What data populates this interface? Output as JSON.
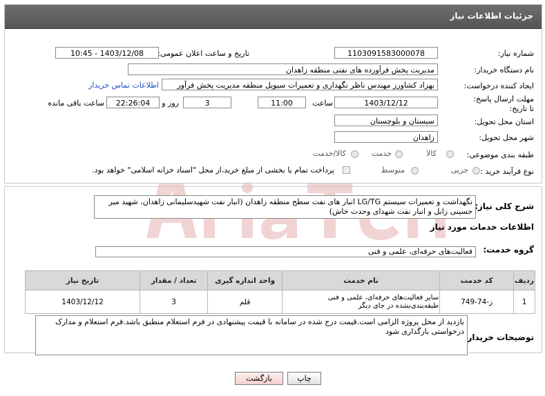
{
  "header": {
    "title": "جزئیات اطلاعات نیاز"
  },
  "fields": {
    "need_number": {
      "label": "شماره نیاز:",
      "value": "1103091583000078"
    },
    "announce_datetime": {
      "label": "تاریخ و ساعت اعلان عمومی:",
      "value": "1403/12/08 - 10:45"
    },
    "buyer_org": {
      "label": "نام دستگاه خریدار:",
      "value": "مدیریت پخش فرآورده های نفتی منطقه زاهدان"
    },
    "requester": {
      "label": "ایجاد کننده درخواست:",
      "value": "بهزاد کشاورز مهندس ناظر نگهداری و تعمیرات سیویل منطقه  مدیریت پخش فرآور"
    },
    "contact_link": "اطلاعات تماس خریدار",
    "deadline": {
      "label": "مهلت ارسال پاسخ: تا تاریخ:",
      "date": "1403/12/12",
      "time_label": "ساعت",
      "time": "11:00",
      "days": "3",
      "days_label": "روز و",
      "remaining": "22:26:04",
      "remaining_label": "ساعت باقی مانده"
    },
    "province": {
      "label": "استان محل تحویل:",
      "value": "سیستان و بلوچستان"
    },
    "city": {
      "label": "شهر محل تحویل:",
      "value": "زاهدان"
    },
    "category": {
      "label": "طبقه بندی موضوعی:",
      "options": [
        "کالا",
        "خدمت",
        "کالا/خدمت"
      ]
    },
    "purchase_type": {
      "label": "نوع فرآیند خرید :",
      "options": [
        "جزیی",
        "متوسط"
      ],
      "note": "پرداخت تمام یا بخشی از مبلغ خرید،از محل \"اسناد خزانه اسلامی\" خواهد بود."
    }
  },
  "summary": {
    "label": "شرح کلی نیاز:",
    "text": "نگهداشت و تعمیرات سیستم LG/TG  انبار های نفت سطح منطقه زاهدان (انبار نفت شهیدسلیمانی زاهدان، شهید میر حسینی زابل و انبار نفت شهدای وحدت خاش)"
  },
  "services": {
    "section_title": "اطلاعات خدمات مورد نیاز",
    "group_label": "گروه خدمت:",
    "group_value": "فعالیت‌های حرفه‌ای، علمی و فنی",
    "columns": [
      "ردیف",
      "کد خدمت",
      "نام خدمت",
      "واحد اندازه گیری",
      "تعداد / مقدار",
      "تاریخ نیاز"
    ],
    "rows": [
      {
        "row": "1",
        "code": "ز-74-749",
        "name": "سایر فعالیت‌های حرفه‌ای، علمی و فنی طبقه‌بندی‌نشده در جای دیگر",
        "unit": "قلم",
        "qty": "3",
        "date": "1403/12/12"
      }
    ]
  },
  "buyer_notes": {
    "label": "توضیحات خریدار:",
    "text": "بازدید از محل پروژه الزامی است.قیمت درج شده در سامانه با قیمت پیشنهادی در فرم استعلام منطبق باشد.فرم استعلام و مدارک درخواستی بارگذاری شود"
  },
  "buttons": {
    "print": "چاپ",
    "back": "بازگشت"
  },
  "colors": {
    "header_bg": "#5f5f5f",
    "link": "#1a4fc4",
    "back_btn_bg": "#fbe3e3",
    "watermark": "#e8b7b7"
  }
}
